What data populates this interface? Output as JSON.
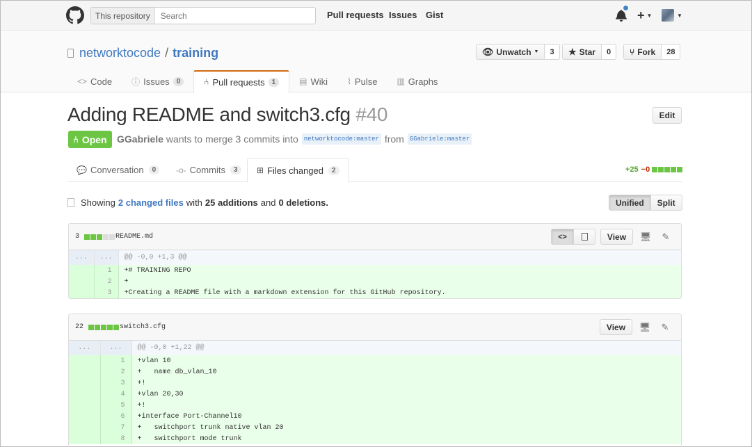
{
  "header": {
    "search_scope": "This repository",
    "search_placeholder": "Search",
    "nav": [
      "Pull requests",
      "Issues",
      "Gist"
    ],
    "plus_label": "+"
  },
  "repo": {
    "owner": "networktocode",
    "separator": "/",
    "name": "training",
    "watch_label": "Unwatch",
    "watch_count": "3",
    "star_label": "Star",
    "star_count": "0",
    "fork_label": "Fork",
    "fork_count": "28",
    "tabs": [
      {
        "label": "Code",
        "count": null
      },
      {
        "label": "Issues",
        "count": "0"
      },
      {
        "label": "Pull requests",
        "count": "1"
      },
      {
        "label": "Wiki",
        "count": null
      },
      {
        "label": "Pulse",
        "count": null
      },
      {
        "label": "Graphs",
        "count": null
      }
    ]
  },
  "pr": {
    "title": "Adding README and switch3.cfg",
    "number": "#40",
    "edit_label": "Edit",
    "state": "Open",
    "author": "GGabriele",
    "meta_text": "wants to merge 3 commits into",
    "base_branch": "networktocode:master",
    "from_text": "from",
    "head_branch": "GGabriele:master",
    "tabs": [
      {
        "label": "Conversation",
        "count": "0"
      },
      {
        "label": "Commits",
        "count": "3"
      },
      {
        "label": "Files changed",
        "count": "2"
      }
    ],
    "additions_label": "+25",
    "deletions_label": "−0"
  },
  "toc": {
    "showing": "Showing",
    "changed_files": "2 changed files",
    "with": "with",
    "additions": "25 additions",
    "and": "and",
    "deletions": "0 deletions.",
    "unified_label": "Unified",
    "split_label": "Split"
  },
  "files": [
    {
      "count": "3",
      "name": "README.md",
      "view_label": "View",
      "hunk_dots": "...",
      "hunk": "@@ -0,0 +1,3 @@",
      "lines": [
        {
          "n": "1",
          "code": "+# TRAINING REPO"
        },
        {
          "n": "2",
          "code": "+"
        },
        {
          "n": "3",
          "code": "+Creating a README file with a markdown extension for this GitHub repository."
        }
      ]
    },
    {
      "count": "22",
      "name": "switch3.cfg",
      "view_label": "View",
      "hunk_dots": "...",
      "hunk": "@@ -0,0 +1,22 @@",
      "lines": [
        {
          "n": "1",
          "code": "+vlan 10"
        },
        {
          "n": "2",
          "code": "+   name db_vlan_10"
        },
        {
          "n": "3",
          "code": "+!"
        },
        {
          "n": "4",
          "code": "+vlan 20,30"
        },
        {
          "n": "5",
          "code": "+!"
        },
        {
          "n": "6",
          "code": "+interface Port-Channel10"
        },
        {
          "n": "7",
          "code": "+   switchport trunk native vlan 20"
        },
        {
          "n": "8",
          "code": "+   switchport mode trunk"
        }
      ]
    }
  ],
  "colors": {
    "link": "#4078c0",
    "open_green": "#6cc644",
    "deletion_red": "#bd2c00",
    "tab_accent": "#d26911"
  }
}
